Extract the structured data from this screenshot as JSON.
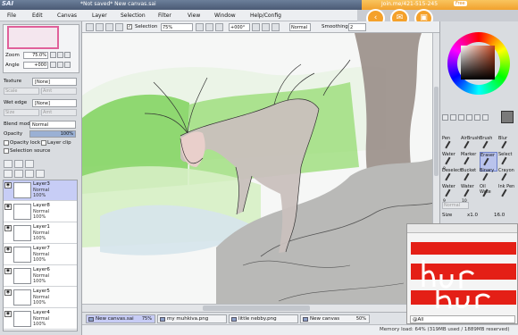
{
  "titlebar": {
    "app_name": "SAI",
    "window_title": "*Not saved* New canvas.sai"
  },
  "menu": [
    {
      "label": "File"
    },
    {
      "label": "Edit"
    },
    {
      "label": "Canvas"
    },
    {
      "label": "Layer"
    },
    {
      "label": "Selection"
    },
    {
      "label": "Filter"
    },
    {
      "label": "View"
    },
    {
      "label": "Window"
    },
    {
      "label": "Help/Config"
    }
  ],
  "toolbar": {
    "selection_label": "Selection",
    "selection_checked": "✓",
    "zoom": "75%",
    "rotation": "+000°",
    "blend": "Normal",
    "smoothing_label": "Smoothing",
    "smoothing_value": "2"
  },
  "navigator": {
    "zoom_label": "Zoom",
    "zoom_value": "75.0%",
    "angle_label": "Angle",
    "angle_value": "+000"
  },
  "brush": {
    "texture_label": "Texture",
    "texture_value": "[None]",
    "scale_label": "Scale",
    "scale_value": "100%",
    "amt_label": "Amt",
    "amt_value": "20",
    "wetedge_label": "Wet edge",
    "wetedge_value": "[None]",
    "size_label": "Size",
    "size_value": "100"
  },
  "layer_props": {
    "blend_label": "Blend mode",
    "blend_value": "Normal",
    "opacity_label": "Opacity",
    "opacity_value": "100%",
    "opacity_fraction": 1.0,
    "opacity_lock": "Opacity lock",
    "layer_clip": "Layer clip",
    "selection_source": "Selection source"
  },
  "layers": [
    {
      "name": "Layer3",
      "mode": "Normal",
      "opacity": "100%",
      "selected": true
    },
    {
      "name": "Layer8",
      "mode": "Normal",
      "opacity": "100%",
      "selected": false
    },
    {
      "name": "Layer1",
      "mode": "Normal",
      "opacity": "100%",
      "selected": false
    },
    {
      "name": "Layer7",
      "mode": "Normal",
      "opacity": "100%",
      "selected": false
    },
    {
      "name": "Layer6",
      "mode": "Normal",
      "opacity": "100%",
      "selected": false
    },
    {
      "name": "Layer5",
      "mode": "Normal",
      "opacity": "100%",
      "selected": false
    },
    {
      "name": "Layer4",
      "mode": "Normal",
      "opacity": "100%",
      "selected": false
    }
  ],
  "tabs": [
    {
      "label": "New canvas.sai",
      "pct": "75%",
      "active": true
    },
    {
      "label": "my muhkiva.png",
      "pct": "",
      "active": false
    },
    {
      "label": "little nebby.png",
      "pct": "",
      "active": false
    },
    {
      "label": "New canvas",
      "pct": "50%",
      "active": false
    }
  ],
  "status": {
    "text": "Memory load: 64% (319MB used / 1889MB reserved)"
  },
  "im": {
    "link": "Join.me/421-515-245",
    "badge": "Free"
  },
  "tools": [
    {
      "label": "Pen",
      "size": ""
    },
    {
      "label": "AirBrush",
      "size": ""
    },
    {
      "label": "Brush",
      "size": ""
    },
    {
      "label": "Blur",
      "size": ""
    },
    {
      "label": "Water",
      "size": "8"
    },
    {
      "label": "Marker",
      "size": ""
    },
    {
      "label": "Eraser",
      "size": "",
      "selected": true
    },
    {
      "label": "Select",
      "size": ""
    },
    {
      "label": "Deselect",
      "size": ""
    },
    {
      "label": "Bucket",
      "size": ""
    },
    {
      "label": "Binary",
      "size": ""
    },
    {
      "label": "Crayon",
      "size": ""
    },
    {
      "label": "Water",
      "size": "9"
    },
    {
      "label": "Water",
      "size": "10"
    },
    {
      "label": "Oil Wate",
      "size": ""
    },
    {
      "label": "Ink Pen",
      "size": ""
    }
  ],
  "tool_props": {
    "size_label": "Size",
    "size_mult": "x1.0",
    "size_value": "16.0",
    "mode": "Normal"
  },
  "chat": {
    "input": "@All"
  },
  "colors": {
    "accent": "#c7ccf5",
    "im_orange": "#f4a12b",
    "grass": "#7fd25c"
  }
}
